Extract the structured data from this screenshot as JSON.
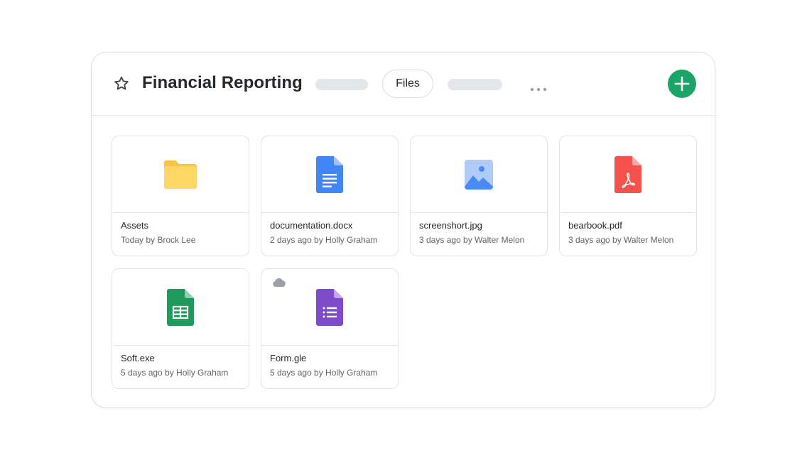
{
  "header": {
    "title": "Financial Reporting",
    "files_tab": "Files"
  },
  "files": [
    {
      "name": "Assets",
      "meta": "Today by Brock Lee",
      "icon": "folder-icon",
      "color": "#fdd663"
    },
    {
      "name": "documentation.docx",
      "meta": "2 days ago by Holly Graham",
      "icon": "docs-icon",
      "color": "#4285f4"
    },
    {
      "name": "screenshort.jpg",
      "meta": "3 days ago by Walter Melon",
      "icon": "image-icon",
      "color": "#4a8af4"
    },
    {
      "name": "bearbook.pdf",
      "meta": "3 days ago by Walter Melon",
      "icon": "pdf-icon",
      "color": "#f4514c"
    },
    {
      "name": "Soft.exe",
      "meta": "5 days ago by Holly Graham",
      "icon": "sheets-icon",
      "color": "#1e9a5b"
    },
    {
      "name": "Form.gle",
      "meta": "5 days ago by Holly Graham",
      "icon": "forms-icon",
      "color": "#7e4ccb",
      "badge": "cloud-icon"
    }
  ],
  "colors": {
    "accent": "#1aa566",
    "border": "#dcdee2",
    "placeholder": "#e4e6e9"
  }
}
